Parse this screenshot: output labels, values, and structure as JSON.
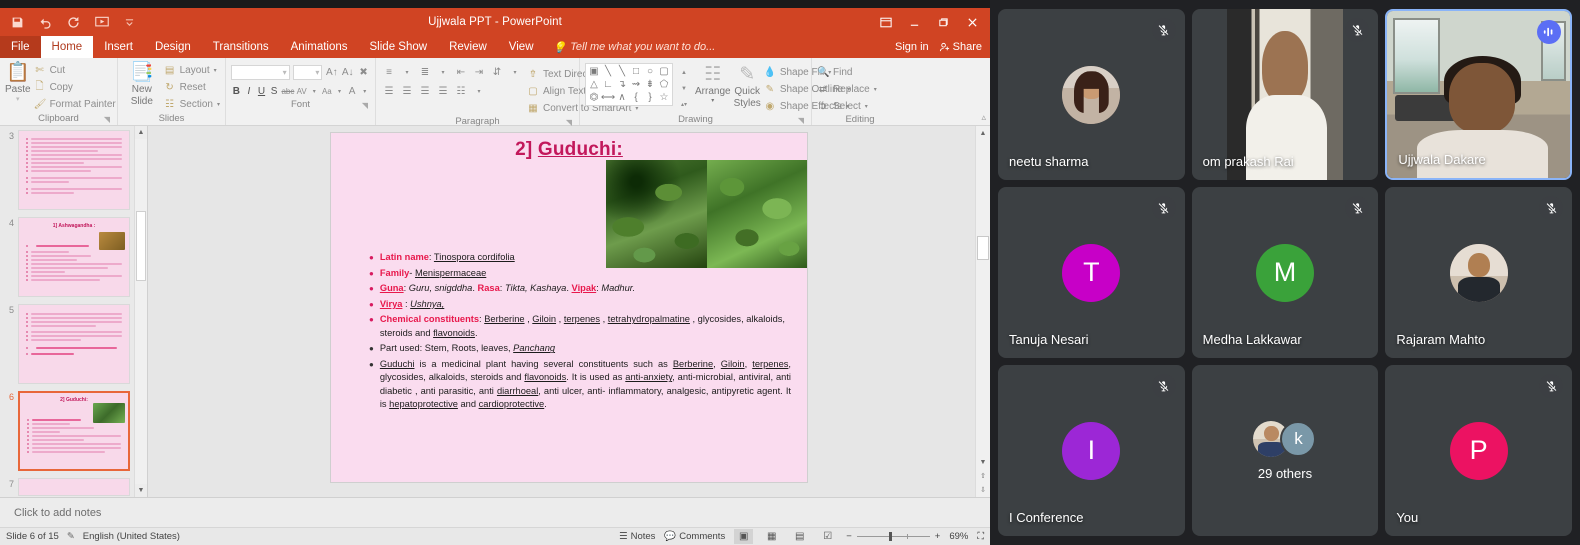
{
  "powerpoint": {
    "title": "Ujjwala PPT - PowerPoint",
    "quick_access": [
      {
        "name": "save-icon",
        "label": "Save"
      },
      {
        "name": "undo-icon",
        "label": "Undo"
      },
      {
        "name": "redo-icon",
        "label": "Redo"
      },
      {
        "name": "start-presentation-icon",
        "label": "Start From Beginning"
      },
      {
        "name": "customize-qat-icon",
        "label": "Customize Quick Access Toolbar"
      }
    ],
    "window_controls": {
      "ribbon_display_options": "⬜",
      "minimize": "–",
      "restore": "❐",
      "close": "✕"
    },
    "tabs": [
      {
        "label": "File",
        "active": false,
        "file": true
      },
      {
        "label": "Home",
        "active": true
      },
      {
        "label": "Insert",
        "active": false
      },
      {
        "label": "Design",
        "active": false
      },
      {
        "label": "Transitions",
        "active": false
      },
      {
        "label": "Animations",
        "active": false
      },
      {
        "label": "Slide Show",
        "active": false
      },
      {
        "label": "Review",
        "active": false
      },
      {
        "label": "View",
        "active": false
      }
    ],
    "tell_me": "Tell me what you want to do...",
    "sign_in": "Sign in",
    "share": "Share",
    "ribbon": {
      "clipboard": {
        "label": "Clipboard",
        "paste": "Paste",
        "cut": "Cut",
        "copy": "Copy",
        "format_painter": "Format Painter"
      },
      "slides": {
        "label": "Slides",
        "new_slide": "New\nSlide",
        "new_slide_line1": "New",
        "new_slide_line2": "Slide",
        "layout": "Layout",
        "reset": "Reset",
        "section": "Section"
      },
      "font": {
        "label": "Font",
        "font_name": "",
        "font_size": "",
        "bold": "B",
        "italic": "I",
        "underline": "U",
        "shadow": "S",
        "strikethrough": "abc",
        "char_spacing": "AV",
        "change_case": "Aa",
        "font_color": "A"
      },
      "paragraph": {
        "label": "Paragraph",
        "text_direction": "Text Direction",
        "align_text": "Align Text",
        "convert_smartart": "Convert to SmartArt"
      },
      "drawing": {
        "label": "Drawing",
        "arrange": "Arrange",
        "quick_styles_line1": "Quick",
        "quick_styles_line2": "Styles",
        "shape_fill": "Shape Fill",
        "shape_outline": "Shape Outline",
        "shape_effects": "Shape Effects"
      },
      "editing": {
        "label": "Editing",
        "find": "Find",
        "replace": "Replace",
        "select": "Select"
      }
    },
    "thumbnails": [
      {
        "number": "3",
        "selected": false,
        "kind": "text"
      },
      {
        "number": "4",
        "selected": false,
        "kind": "title-img",
        "title": "1] Ashwagandha :"
      },
      {
        "number": "5",
        "selected": false,
        "kind": "text"
      },
      {
        "number": "6",
        "selected": true,
        "kind": "title-img",
        "title": "2] Guduchi:"
      },
      {
        "number": "7",
        "selected": false,
        "kind": "text"
      }
    ],
    "slide": {
      "title_prefix": "2] ",
      "title_main": "Guduchi:",
      "bullets": [
        {
          "bullet_color": "pink",
          "parts": [
            {
              "text": "Latin name",
              "style": "red"
            },
            {
              "text": ": ",
              "style": "plain"
            },
            {
              "text": "Tinospora cordifolia",
              "style": "u"
            }
          ]
        },
        {
          "bullet_color": "pink",
          "parts": [
            {
              "text": "Family",
              "style": "red"
            },
            {
              "text": "- ",
              "style": "plain"
            },
            {
              "text": "Menispermaceae",
              "style": "u"
            }
          ]
        },
        {
          "bullet_color": "pink",
          "parts": [
            {
              "text": "Guna",
              "style": "redu"
            },
            {
              "text": ": ",
              "style": "plain"
            },
            {
              "text": "Guru, snigddha",
              "style": "it"
            },
            {
              "text": ".  ",
              "style": "plain"
            },
            {
              "text": "Rasa",
              "style": "red"
            },
            {
              "text": ": ",
              "style": "plain"
            },
            {
              "text": "Tikta, Kashaya",
              "style": "it"
            },
            {
              "text": ".  ",
              "style": "plain"
            },
            {
              "text": "Vipak",
              "style": "redu"
            },
            {
              "text": ": ",
              "style": "plain"
            },
            {
              "text": "Madhur.",
              "style": "it"
            }
          ]
        },
        {
          "bullet_color": "pink",
          "parts": [
            {
              "text": "Virya",
              "style": "redu"
            },
            {
              "text": " : ",
              "style": "plain"
            },
            {
              "text": "Ushnya,",
              "style": "it-u"
            }
          ]
        },
        {
          "bullet_color": "pink",
          "parts": [
            {
              "text": "Chemical constituents",
              "style": "red"
            },
            {
              "text": ": ",
              "style": "plain"
            },
            {
              "text": "Berberine",
              "style": "u"
            },
            {
              "text": " , ",
              "style": "plain"
            },
            {
              "text": "Giloin",
              "style": "u"
            },
            {
              "text": " , ",
              "style": "plain"
            },
            {
              "text": "terpenes",
              "style": "u"
            },
            {
              "text": " , ",
              "style": "plain"
            },
            {
              "text": "tetrahydropalmatine",
              "style": "u"
            },
            {
              "text": " , glycosides, alkaloids, steroids and ",
              "style": "plain"
            },
            {
              "text": "flavonoids",
              "style": "u"
            },
            {
              "text": ".",
              "style": "plain"
            }
          ]
        },
        {
          "bullet_color": "dark",
          "parts": [
            {
              "text": "Part used: Stem, Roots, leaves, ",
              "style": "plain"
            },
            {
              "text": "Panchang",
              "style": "it-u"
            }
          ]
        },
        {
          "bullet_color": "dark",
          "justify": true,
          "parts": [
            {
              "text": "Guduchi",
              "style": "u"
            },
            {
              "text": " is a medicinal plant having several constituents such as ",
              "style": "plain"
            },
            {
              "text": "Berberine",
              "style": "u"
            },
            {
              "text": ",  ",
              "style": "plain"
            },
            {
              "text": "Giloin",
              "style": "u"
            },
            {
              "text": ", ",
              "style": "plain"
            },
            {
              "text": "terpenes",
              "style": "u"
            },
            {
              "text": ", glycosides, alkaloids, steroids and ",
              "style": "plain"
            },
            {
              "text": "flavonoids",
              "style": "u"
            },
            {
              "text": ". It is used as ",
              "style": "plain"
            },
            {
              "text": "anti-anxiety",
              "style": "u"
            },
            {
              "text": ", anti-microbial, antiviral, anti diabetic , anti parasitic,  anti ",
              "style": "plain"
            },
            {
              "text": "diarrhoeal",
              "style": "u"
            },
            {
              "text": ", anti ulcer, anti- inflammatory, analgesic, antipyretic agent. It is ",
              "style": "plain"
            },
            {
              "text": "hepatoprotective",
              "style": "u"
            },
            {
              "text": " and ",
              "style": "plain"
            },
            {
              "text": "cardioprotective",
              "style": "u"
            },
            {
              "text": ".",
              "style": "plain"
            }
          ]
        }
      ]
    },
    "notes_placeholder": "Click to add notes",
    "status": {
      "slide_indicator": "Slide 6 of 15",
      "language": "English (United States)",
      "notes_button": "Notes",
      "comments_button": "Comments",
      "zoom_level": "69%"
    }
  },
  "meeting": {
    "tiles": [
      {
        "name": "neetu sharma",
        "type": "avatar-photo",
        "photo": "neetu",
        "muted": true,
        "active": false
      },
      {
        "name": "om prakash Rai",
        "type": "video",
        "feed": "om",
        "muted": true,
        "active": false
      },
      {
        "name": "Ujjwala Dakare",
        "type": "video",
        "feed": "uj",
        "muted": false,
        "speaking": true,
        "active": true
      },
      {
        "name": "Tanuja Nesari",
        "type": "initial",
        "initial": "T",
        "color": "#c700c7",
        "muted": true,
        "active": false
      },
      {
        "name": "Medha Lakkawar",
        "type": "initial",
        "initial": "M",
        "color": "#3aa23a",
        "muted": true,
        "active": false
      },
      {
        "name": "Rajaram Mahto",
        "type": "avatar-photo",
        "photo": "raja",
        "muted": true,
        "active": false
      },
      {
        "name": "I Conference",
        "type": "initial",
        "initial": "I",
        "color": "#9c27d6",
        "muted": true,
        "active": false
      },
      {
        "name": "29 others",
        "type": "others",
        "initial": "k",
        "color": "#7a98a8",
        "muted": false,
        "active": false,
        "is_others": true
      },
      {
        "name": "You",
        "type": "initial",
        "initial": "P",
        "color": "#ec1262",
        "muted": true,
        "active": false
      }
    ],
    "colors": {
      "background": "#202124",
      "tile": "#3c4043",
      "active_border": "#8ab4f8",
      "speaking_badge": "#5b6ef5"
    }
  }
}
